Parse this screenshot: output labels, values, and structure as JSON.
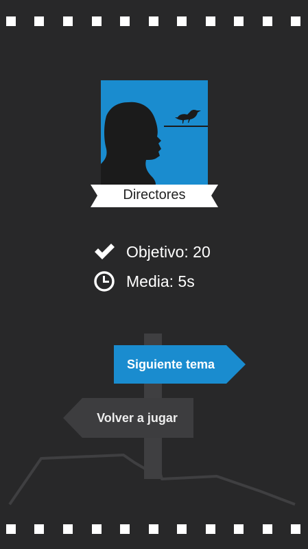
{
  "category": {
    "name": "Directores",
    "image_icon": "director-silhouette-with-bird-icon",
    "accent_color": "#1a8ccf"
  },
  "stats": {
    "goal": "Objetivo: 20",
    "goal_icon": "checkmark-icon",
    "average": "Media: 5s",
    "average_icon": "clock-icon"
  },
  "actions": {
    "next_topic": "Siguiente tema",
    "next_topic_color": "#1a8ccf",
    "replay": "Volver a jugar",
    "replay_color": "#3d3d3f"
  },
  "colors": {
    "background": "#282829",
    "film_holes": "#ffffff"
  }
}
